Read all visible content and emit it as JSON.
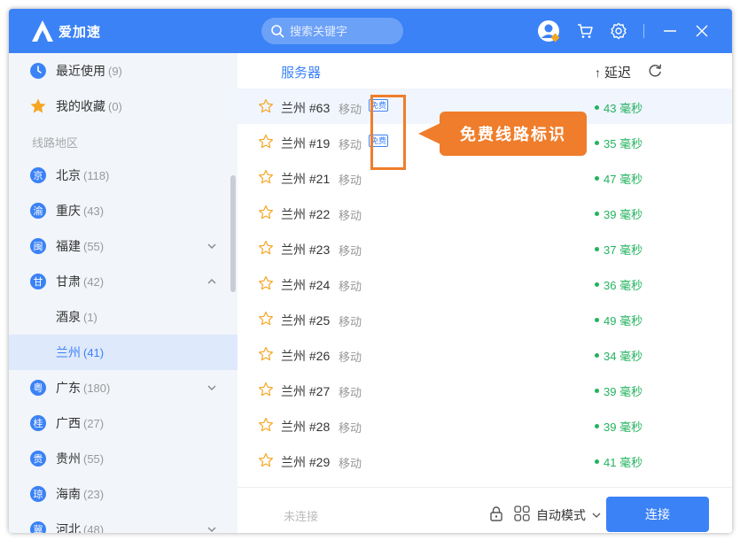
{
  "app": {
    "name": "爱加速"
  },
  "search": {
    "placeholder": "搜索关键字"
  },
  "sidebar": {
    "recent": {
      "label": "最近使用",
      "count": "(9)"
    },
    "favorites": {
      "label": "我的收藏",
      "count": "(0)"
    },
    "section_title": "线路地区",
    "regions": [
      {
        "badge": "京",
        "label": "北京",
        "count": "(118)"
      },
      {
        "badge": "渝",
        "label": "重庆",
        "count": "(43)"
      },
      {
        "badge": "闽",
        "label": "福建",
        "count": "(55)"
      },
      {
        "badge": "甘",
        "label": "甘肃",
        "count": "(42)"
      },
      {
        "label": "酒泉",
        "count": "(1)"
      },
      {
        "label": "兰州",
        "count": "(41)"
      },
      {
        "badge": "粤",
        "label": "广东",
        "count": "(180)"
      },
      {
        "badge": "桂",
        "label": "广西",
        "count": "(27)"
      },
      {
        "badge": "贵",
        "label": "贵州",
        "count": "(55)"
      },
      {
        "badge": "琼",
        "label": "海南",
        "count": "(23)"
      },
      {
        "badge": "冀",
        "label": "河北",
        "count": "(48)"
      }
    ]
  },
  "main": {
    "column_server": "服务器",
    "column_latency": "延迟",
    "sort_arrow": "↑",
    "servers": [
      {
        "name": "兰州 #63",
        "isp": "移动",
        "badge": "免费",
        "latency": "43 毫秒"
      },
      {
        "name": "兰州 #19",
        "isp": "移动",
        "badge": "免费",
        "latency": "35 毫秒"
      },
      {
        "name": "兰州 #21",
        "isp": "移动",
        "latency": "47 毫秒"
      },
      {
        "name": "兰州 #22",
        "isp": "移动",
        "latency": "39 毫秒"
      },
      {
        "name": "兰州 #23",
        "isp": "移动",
        "latency": "37 毫秒"
      },
      {
        "name": "兰州 #24",
        "isp": "移动",
        "latency": "36 毫秒"
      },
      {
        "name": "兰州 #25",
        "isp": "移动",
        "latency": "49 毫秒"
      },
      {
        "name": "兰州 #26",
        "isp": "移动",
        "latency": "34 毫秒"
      },
      {
        "name": "兰州 #27",
        "isp": "移动",
        "latency": "39 毫秒"
      },
      {
        "name": "兰州 #28",
        "isp": "移动",
        "latency": "39 毫秒"
      },
      {
        "name": "兰州 #29",
        "isp": "移动",
        "latency": "41 毫秒"
      }
    ]
  },
  "footer": {
    "status": "未连接",
    "mode": "自动模式",
    "connect_label": "连接"
  },
  "annotation": {
    "callout": "免费线路标识"
  },
  "colors": {
    "brand": "#3b82f6",
    "latency_good": "#22b35e",
    "annotation": "#ef7d2b",
    "sidebar_bg": "#f2f5fa",
    "active_bg": "#dfe9fc"
  },
  "icons": [
    "logo-icon",
    "search-icon",
    "avatar-icon",
    "cart-icon",
    "gear-icon",
    "minimize-icon",
    "close-icon",
    "clock-icon",
    "star-icon",
    "chevron-down-icon",
    "chevron-up-icon",
    "refresh-icon",
    "lock-icon",
    "grid-icon"
  ]
}
